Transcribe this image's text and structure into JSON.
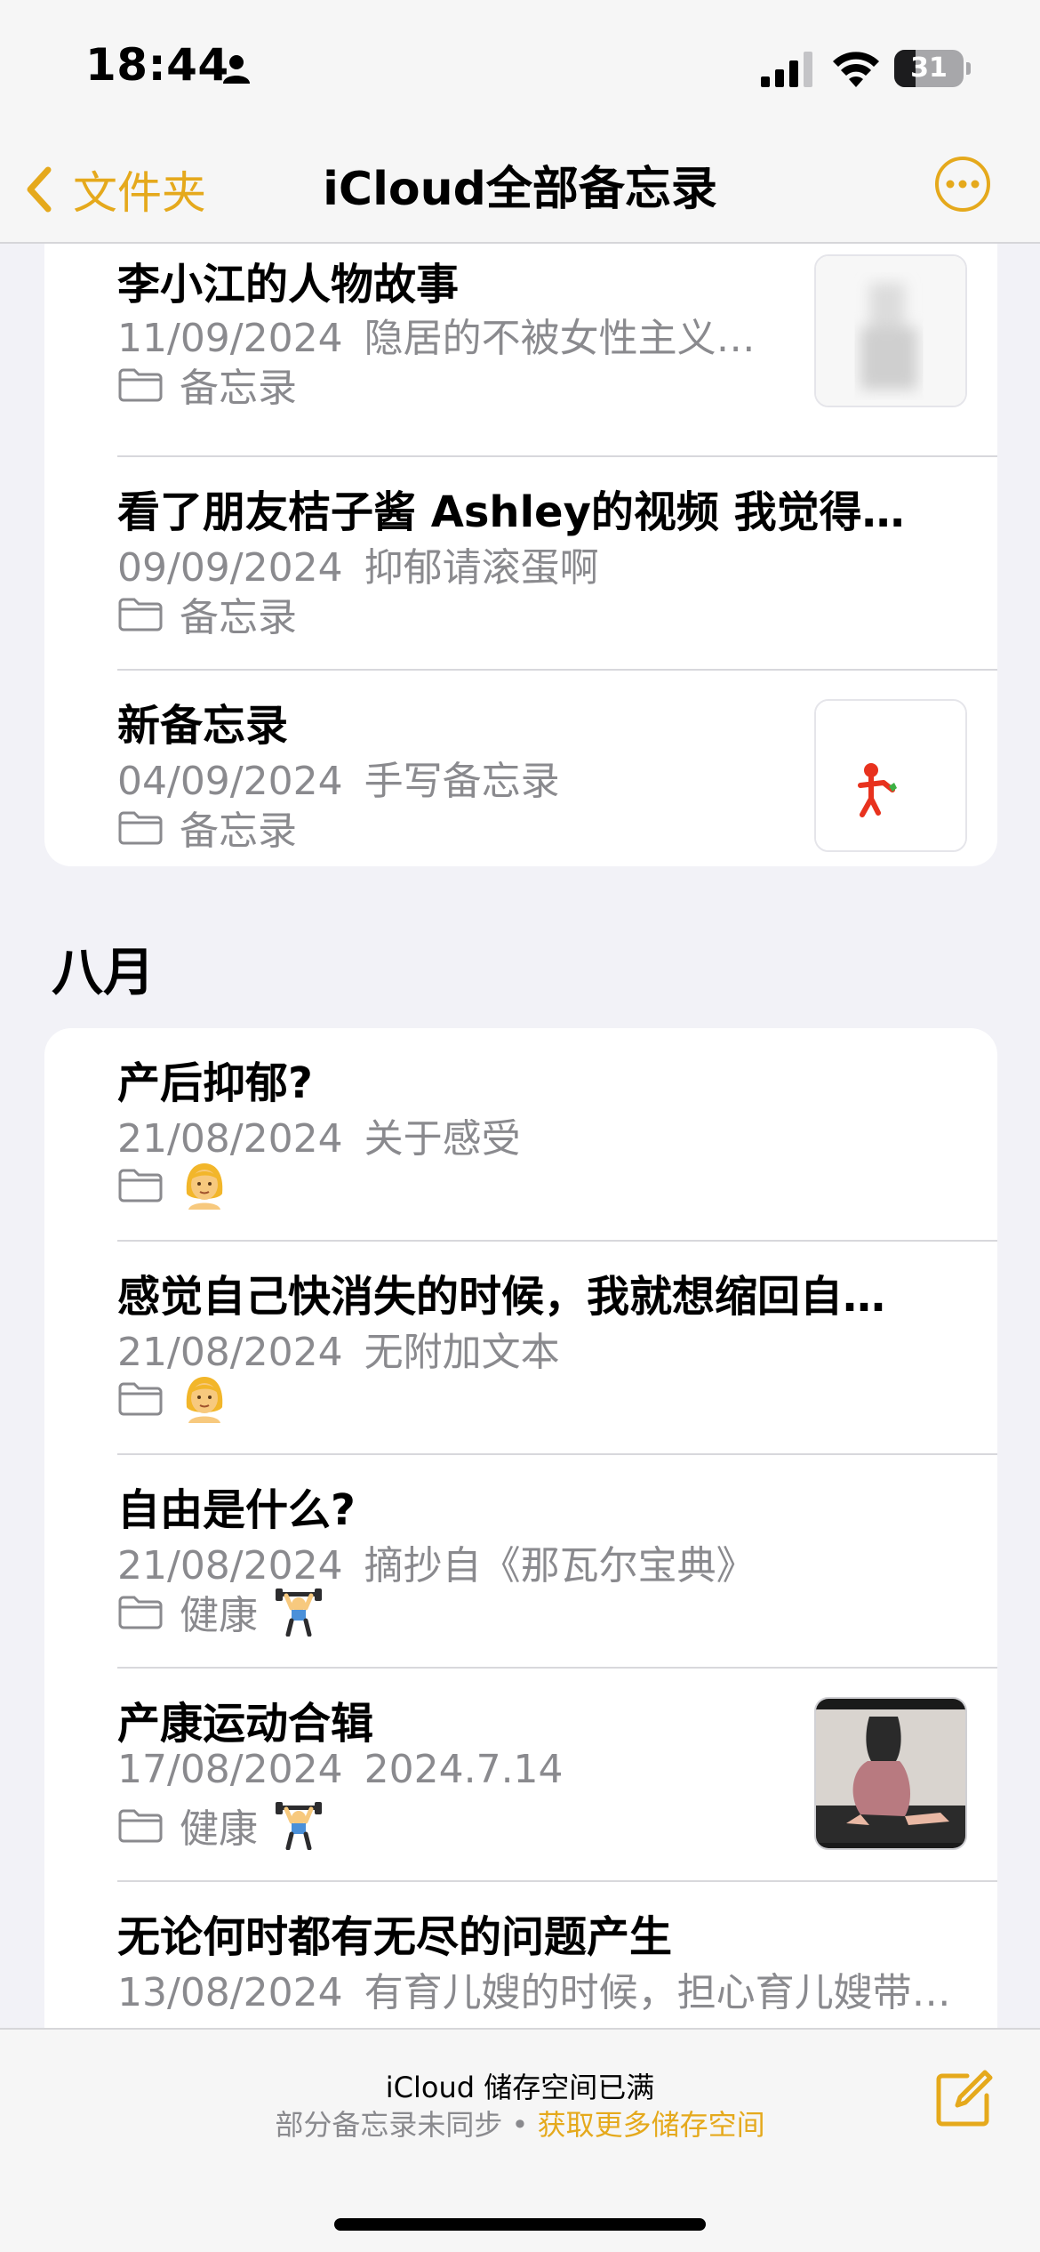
{
  "status_bar": {
    "time": "18:44",
    "battery_level": "31",
    "battery_fraction": 0.31,
    "icons": [
      "person-icon",
      "signal-icon",
      "wifi-icon",
      "battery-icon"
    ]
  },
  "nav": {
    "back_label": "文件夹",
    "title": "iCloud全部备忘录",
    "accent_color": "#e5a91c"
  },
  "notes_top": [
    {
      "title": "李小江的人物故事",
      "date": "11/09/2024",
      "preview": "隐居的不被女性主义…",
      "folder": "备忘录",
      "thumbnail": "blurred-photo"
    },
    {
      "title": "看了朋友桔子酱 Ashley的视频 我觉得…",
      "date": "09/09/2024",
      "preview": "抑郁请滚蛋啊",
      "folder": "备忘录"
    },
    {
      "title": "新备忘录",
      "date": "04/09/2024",
      "preview": "手写备忘录",
      "folder": "备忘录",
      "thumbnail": "handwritten-sketch"
    }
  ],
  "section_august": {
    "header": "八月",
    "notes": [
      {
        "title": "产后抑郁?",
        "date": "21/08/2024",
        "preview": "关于感受",
        "folder_icon": "woman-emoji"
      },
      {
        "title": "感觉自己快消失的时候，我就想缩回自…",
        "date": "21/08/2024",
        "preview": "无附加文本",
        "folder_icon": "woman-emoji"
      },
      {
        "title": "自由是什么?",
        "date": "21/08/2024",
        "preview": "摘抄自《那瓦尔宝典》",
        "folder": "健康",
        "folder_icon": "weightlifter-emoji"
      },
      {
        "title": "产康运动合辑",
        "date": "17/08/2024",
        "preview": "2024.7.14",
        "folder": "健康",
        "folder_icon": "weightlifter-emoji",
        "thumbnail": "exercise-video"
      },
      {
        "title": "无论何时都有无尽的问题产生",
        "date": "13/08/2024",
        "preview": "有育儿嫂的时候，担心育儿嫂带…"
      }
    ]
  },
  "bottom_bar": {
    "storage_title": "iCloud 储存空间已满",
    "storage_sub": "部分备忘录未同步 • ",
    "storage_link": "获取更多储存空间"
  }
}
